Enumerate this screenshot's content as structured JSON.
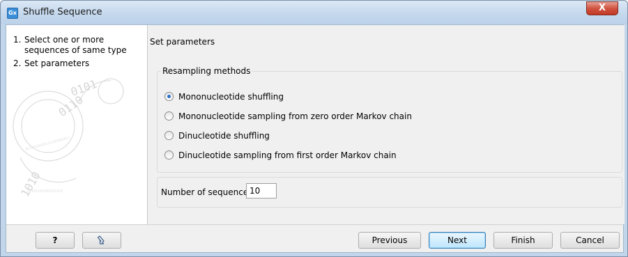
{
  "window": {
    "title": "Shuffle Sequence",
    "app_icon_text": "Gx",
    "close_glyph": "X"
  },
  "steps": [
    {
      "number": "1.",
      "label": "Select one or more sequences of same type"
    },
    {
      "number": "2.",
      "label": "Set parameters"
    }
  ],
  "panel": {
    "heading": "Set parameters",
    "resampling_group": {
      "title": "Resampling methods",
      "options": [
        {
          "label": "Mononucleotide shuffling",
          "checked": true
        },
        {
          "label": "Mononucleotide sampling from zero order Markov chain",
          "checked": false
        },
        {
          "label": "Dinucleotide shuffling",
          "checked": false
        },
        {
          "label": "Dinucleotide sampling from first order Markov chain",
          "checked": false
        }
      ]
    },
    "number_of_sequences": {
      "label": "Number of sequences:",
      "value": "10"
    }
  },
  "buttons": {
    "help": "?",
    "reset_icon": "undo-arrow-icon",
    "previous": "Previous",
    "next": "Next",
    "finish": "Finish",
    "cancel": "Cancel"
  },
  "colors": {
    "title_bar": "#c3d7ec",
    "close_button": "#c23a24",
    "radio_selected": "#2a6fc9",
    "default_button": "#bee6fd"
  }
}
